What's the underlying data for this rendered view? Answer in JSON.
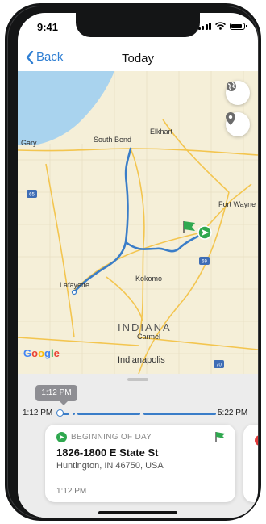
{
  "status_bar": {
    "time": "9:41"
  },
  "nav": {
    "back_label": "Back",
    "title": "Today"
  },
  "map": {
    "cities": [
      {
        "name": "Gary"
      },
      {
        "name": "South Bend"
      },
      {
        "name": "Elkhart"
      },
      {
        "name": "Fort Wayne"
      },
      {
        "name": "Lafayette"
      },
      {
        "name": "Kokomo"
      },
      {
        "name": "Carmel"
      },
      {
        "name": "Indianapolis"
      }
    ],
    "state_label": "INDIANA",
    "highway_shields": [
      "65",
      "69",
      "70"
    ],
    "attribution": [
      "G",
      "o",
      "o",
      "g",
      "l",
      "e"
    ],
    "colors": {
      "water": "#a9d3ee",
      "land": "#f5efd8",
      "route": "#3a7dc8",
      "start": "#2fa84f"
    }
  },
  "timeline": {
    "tooltip": "1:12 PM",
    "start_time": "1:12 PM",
    "end_time": "5:22 PM"
  },
  "card": {
    "label": "BEGINNING OF DAY",
    "street": "1826-1800 E State St",
    "city": "Huntington, IN 46750, USA",
    "time": "1:12 PM"
  }
}
